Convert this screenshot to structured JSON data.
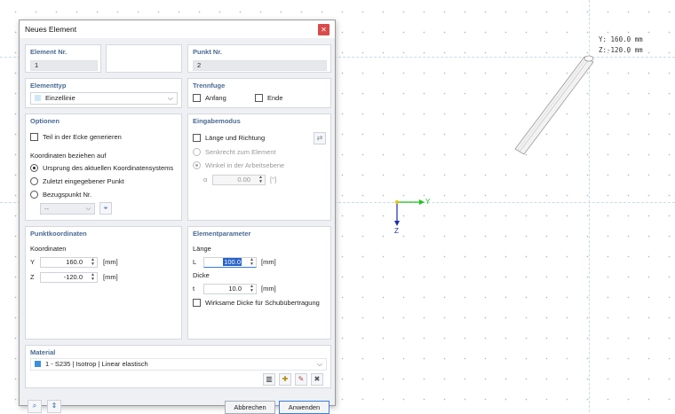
{
  "canvas": {
    "coord_y": "Y: 160.0 mm",
    "coord_z": "Z:-120.0 mm",
    "axis_y": "Y",
    "axis_z": "Z",
    "accent": "#1ec41e"
  },
  "dialog": {
    "title": "Neues Element",
    "close_icon": "close-icon",
    "element_nr": {
      "label": "Element Nr.",
      "value": "1"
    },
    "punkt_nr": {
      "label": "Punkt Nr.",
      "value": "2"
    },
    "elementtyp": {
      "label": "Elementtyp",
      "value": "Einzellinie"
    },
    "trennfuge": {
      "label": "Trennfuge",
      "anfang": "Anfang",
      "ende": "Ende"
    },
    "optionen": {
      "label": "Optionen",
      "teil_ecke": "Teil in der Ecke generieren",
      "koord_bezug": "Koordinaten beziehen auf",
      "radio_ursprung": "Ursprung des aktuellen Koordinatensystems",
      "radio_zuletzt": "Zuletzt eingegebener Punkt",
      "radio_bezug": "Bezugspunkt Nr.",
      "bezug_value": "--"
    },
    "eingabemodus": {
      "label": "Eingabemodus",
      "laenge_richtung": "Länge und Richtung",
      "senkrecht": "Senkrecht zum Element",
      "winkel": "Winkel in der Arbeitsebene",
      "alpha_symbol": "α",
      "alpha_value": "0.00",
      "alpha_unit": "[°]"
    },
    "punktkoordinaten": {
      "label": "Punktkoordinaten",
      "koordinaten": "Koordinaten",
      "y_label": "Y",
      "y_value": "160.0",
      "z_label": "Z",
      "z_value": "-120.0",
      "unit": "[mm]"
    },
    "elementparameter": {
      "label": "Elementparameter",
      "laenge": "Länge",
      "l_label": "L",
      "l_value": "100.0",
      "dicke": "Dicke",
      "t_label": "t",
      "t_value": "10.0",
      "unit": "[mm]",
      "wirksame": "Wirksame Dicke für Schubübertragung"
    },
    "material": {
      "label": "Material",
      "value": "1 - S235 | Isotrop | Linear elastisch",
      "swatch_color": "#3b8fe0"
    },
    "footer": {
      "abbrechen": "Abbrechen",
      "anwenden": "Anwenden"
    }
  }
}
